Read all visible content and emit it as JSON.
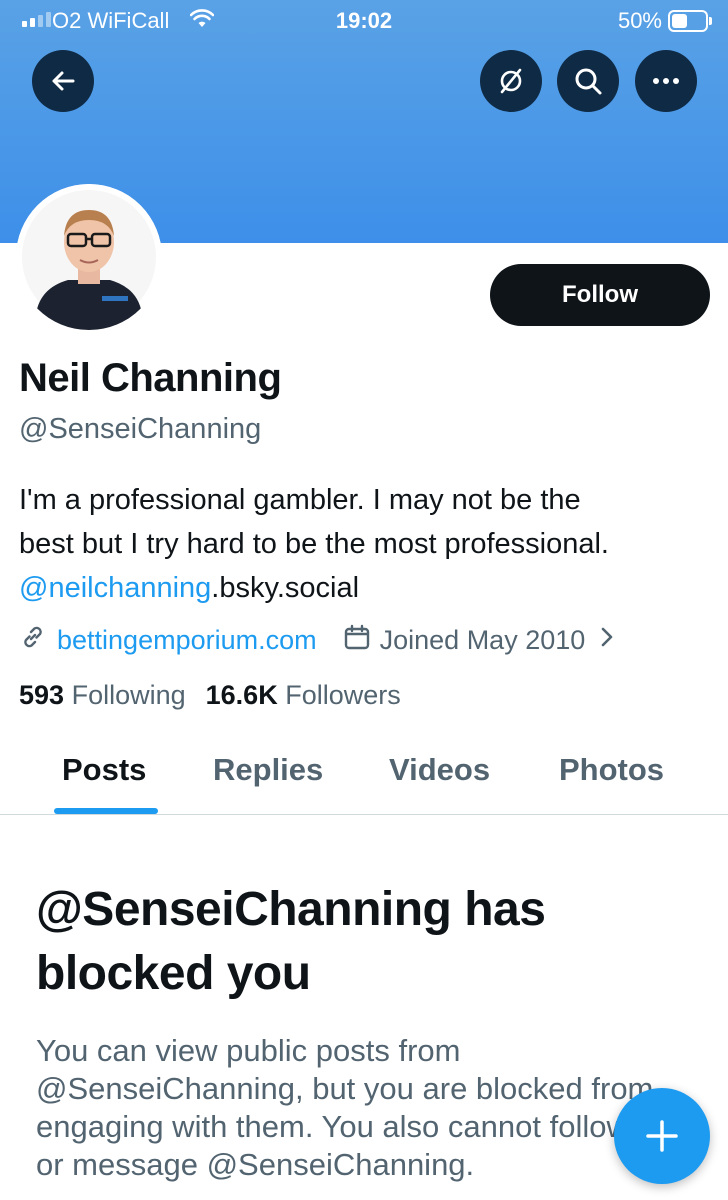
{
  "status_bar": {
    "carrier": "O2 WiFiCall",
    "time": "19:02",
    "battery_percent": "50%",
    "icons": [
      "signal-icon",
      "wifi-icon",
      "battery-icon"
    ]
  },
  "header": {
    "back_icon": "arrow-left-icon",
    "buttons": [
      "no-translate-icon",
      "search-icon",
      "more-icon"
    ],
    "banner_color": "#4a99e8"
  },
  "profile": {
    "display_name": "Neil Channing",
    "handle": "@SenseiChanning",
    "follow_label": "Follow",
    "bio_line1": "I'm a professional gambler. I may not be the",
    "bio_line2": "best but I try hard to be the most professional.",
    "bio_mention": "@neilchanning",
    "bio_suffix": ".bsky.social",
    "website": "bettingemporium.com",
    "joined": "Joined May 2010",
    "following_count": "593",
    "following_label": "Following",
    "followers_count": "16.6K",
    "followers_label": "Followers"
  },
  "tabs": [
    {
      "label": "Posts",
      "active": true
    },
    {
      "label": "Replies",
      "active": false
    },
    {
      "label": "Videos",
      "active": false
    },
    {
      "label": "Photos",
      "active": false
    }
  ],
  "blocked": {
    "title_line1": "@SenseiChanning has",
    "title_line2": "blocked you",
    "body_line1": "You can view public posts from",
    "body_line2": "@SenseiChanning, but you are blocked from",
    "body_line3": "engaging with them. You also cannot follow",
    "body_line4": "or message @SenseiChanning."
  },
  "fab": {
    "icon": "plus-icon"
  },
  "colors": {
    "accent": "#1d9bf0",
    "text": "#0f1419",
    "muted": "#536471"
  }
}
